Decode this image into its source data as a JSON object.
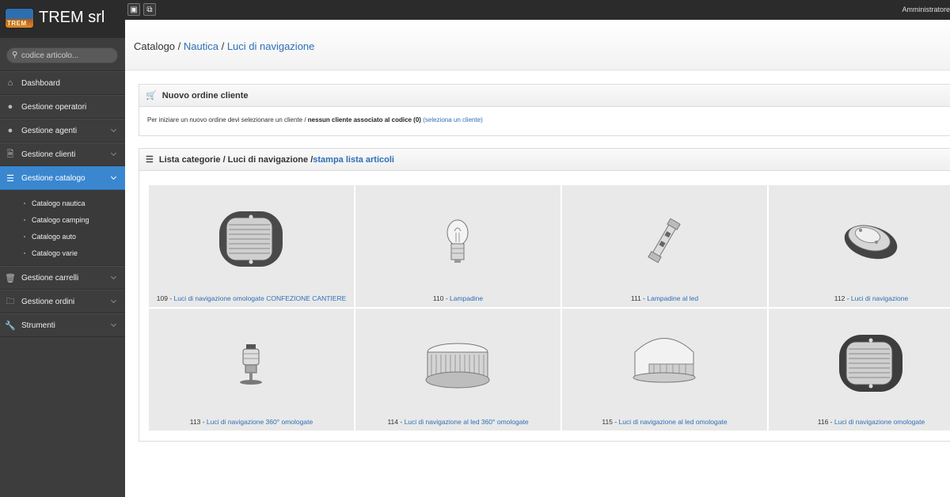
{
  "brand": {
    "name": "TREM srl",
    "logo_text": "TREM"
  },
  "topbar": {
    "user": "Amministratore"
  },
  "search": {
    "placeholder": "codice articolo..."
  },
  "sidebar": {
    "items": [
      {
        "label": "Dashboard",
        "icon": "home-icon"
      },
      {
        "label": "Gestione operatori",
        "icon": "user-icon"
      },
      {
        "label": "Gestione agenti",
        "icon": "user-icon"
      },
      {
        "label": "Gestione clienti",
        "icon": "file-icon"
      },
      {
        "label": "Gestione catalogo",
        "icon": "list-icon"
      },
      {
        "label": "Gestione carrelli",
        "icon": "trash-icon"
      },
      {
        "label": "Gestione ordini",
        "icon": "folder-icon"
      },
      {
        "label": "Strumenti",
        "icon": "wrench-icon"
      }
    ],
    "submenu": [
      "Catalogo nautica",
      "Catalogo camping",
      "Catalogo auto",
      "Catalogo varie"
    ]
  },
  "breadcrumb": {
    "root": "Catalogo",
    "sep": " / ",
    "level1": "Nautica",
    "level2": "Luci di navigazione"
  },
  "order_panel": {
    "title": "Nuovo ordine cliente",
    "text_before": "Per iniziare un nuovo ordine devi selezionare un cliente / ",
    "text_bold": "nessun cliente associato al codice (0)",
    "link": "(seleziona un cliente)"
  },
  "category_panel": {
    "title_prefix": "Lista categorie / Luci di navigazione / ",
    "print_link": "stampa lista articoli"
  },
  "categories": [
    {
      "code": "109 - ",
      "name": "Luci di navigazione omologate CONFEZIONE CANTIERE",
      "image": "side-light"
    },
    {
      "code": "110 - ",
      "name": "Lampadine",
      "image": "bulb"
    },
    {
      "code": "111 - ",
      "name": "Lampadine al led",
      "image": "led-festoon"
    },
    {
      "code": "112 - ",
      "name": "Luci di navigazione",
      "image": "oval-light"
    },
    {
      "code": "113 - ",
      "name": "Luci di navigazione 360° omologate",
      "image": "pole-light"
    },
    {
      "code": "114 - ",
      "name": "Luci di navigazione al led 360° omologate",
      "image": "round-led-light"
    },
    {
      "code": "115 - ",
      "name": "Luci di navigazione al led omologate",
      "image": "dome-led-light"
    },
    {
      "code": "116 - ",
      "name": "Luci di navigazione omologate",
      "image": "side-light"
    }
  ]
}
